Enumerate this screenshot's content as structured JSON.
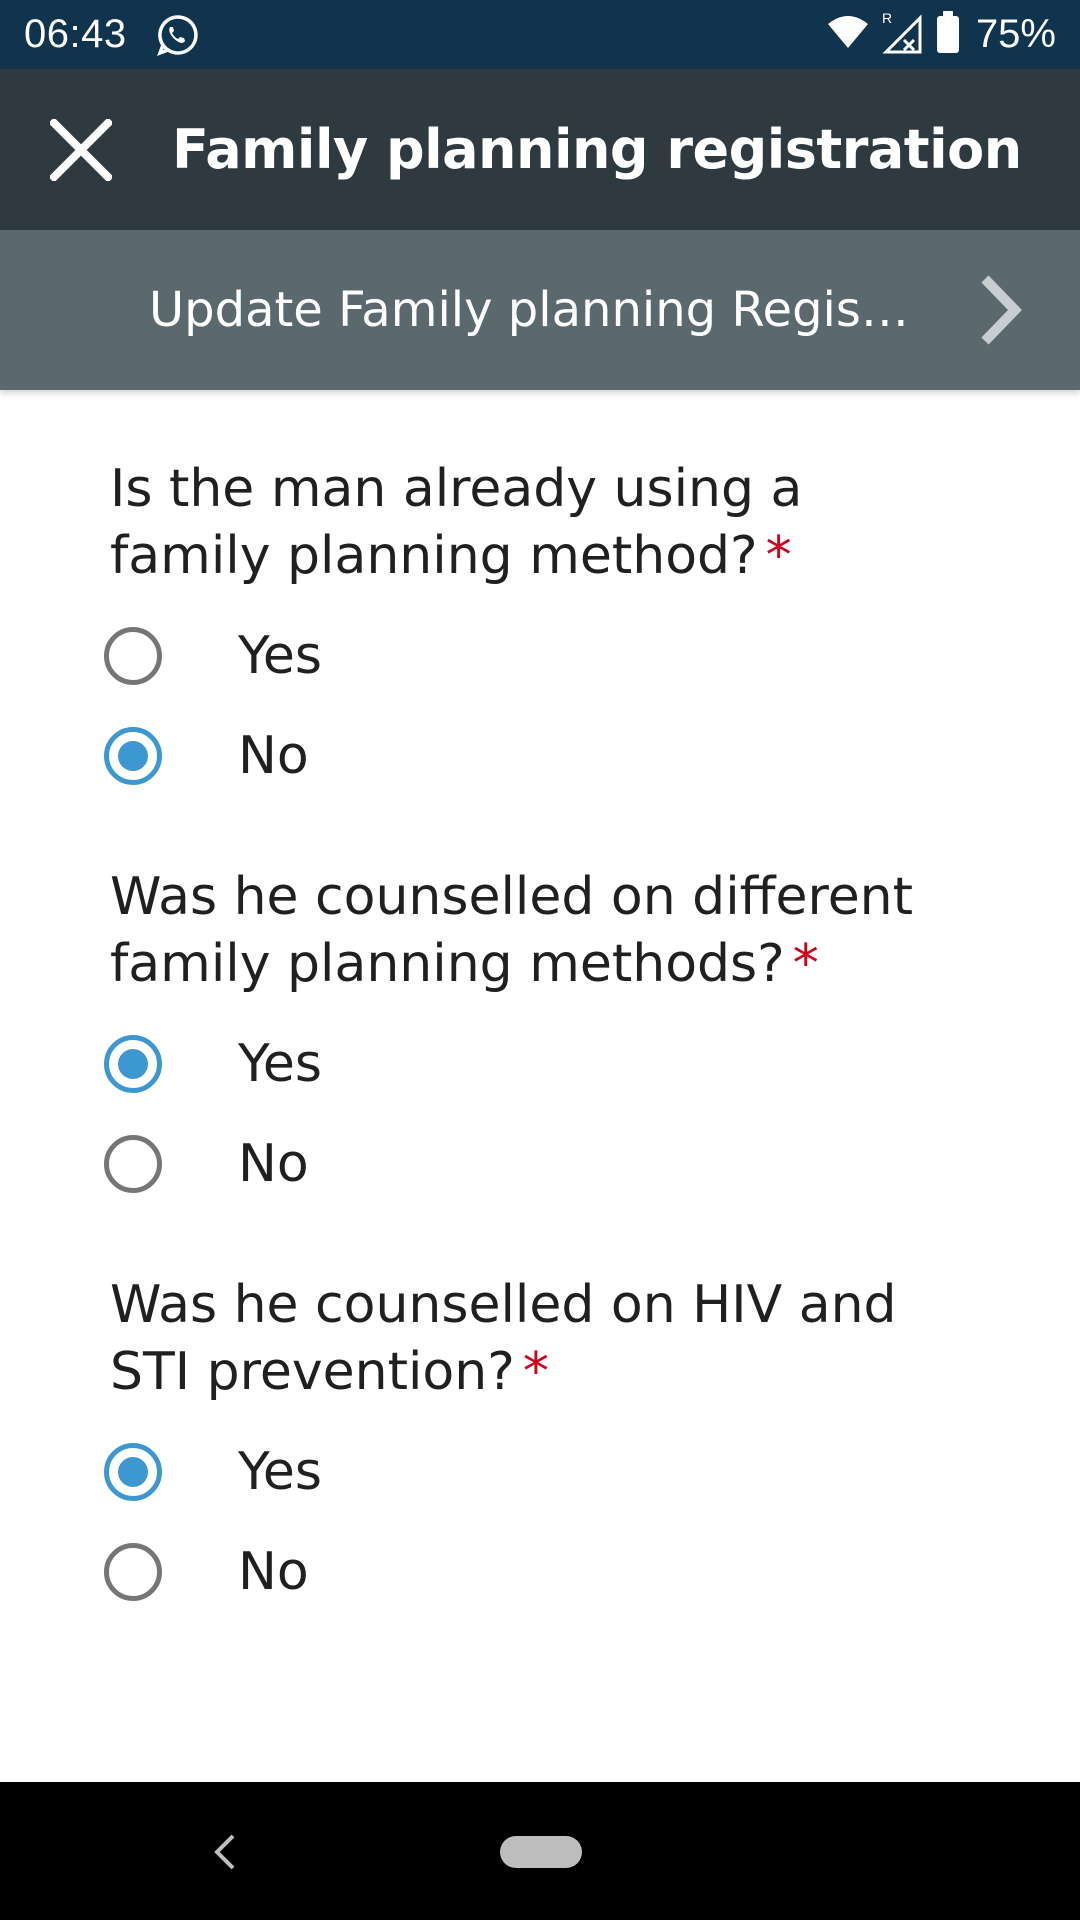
{
  "status_bar": {
    "time": "06:43",
    "battery": "75%",
    "icons": [
      "whatsapp-icon",
      "wifi-icon",
      "signal-roaming-icon",
      "battery-icon"
    ]
  },
  "app_bar": {
    "title": "Family planning registration",
    "close_icon": "close-icon"
  },
  "section": {
    "title": "Update Family planning Registr…",
    "next_icon": "chevron-right-icon"
  },
  "questions": [
    {
      "label": "Is the man already using a family planning method?",
      "required": "*",
      "options": [
        {
          "label": "Yes",
          "selected": false
        },
        {
          "label": "No",
          "selected": true
        }
      ]
    },
    {
      "label": "Was he counselled on different family planning methods?",
      "required": "*",
      "options": [
        {
          "label": "Yes",
          "selected": true
        },
        {
          "label": "No",
          "selected": false
        }
      ]
    },
    {
      "label": "Was he counselled on HIV and STI prevention?",
      "required": "*",
      "options": [
        {
          "label": "Yes",
          "selected": true
        },
        {
          "label": "No",
          "selected": false
        }
      ]
    }
  ],
  "colors": {
    "status_bar": "#11344e",
    "app_bar": "#2f3a40",
    "section_bar": "#5b686e",
    "radio_selected": "#3d98d1",
    "required": "#d0021b"
  }
}
